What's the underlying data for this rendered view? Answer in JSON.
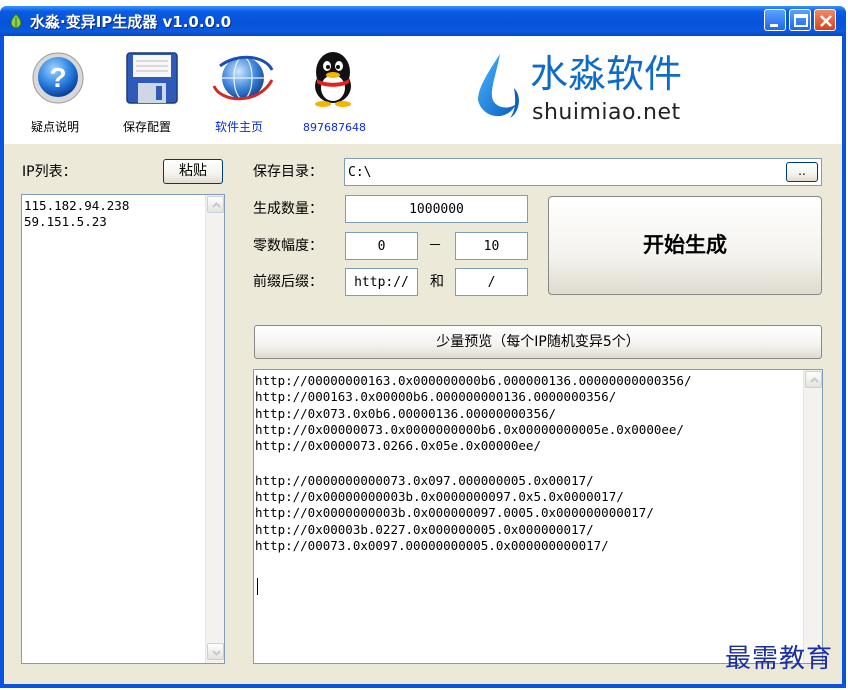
{
  "window": {
    "title": "水淼·变异IP生成器 v1.0.0.0"
  },
  "toolbar": {
    "items": [
      {
        "label": "疑点说明",
        "icon": "help-question-icon"
      },
      {
        "label": "保存配置",
        "icon": "floppy-disk-icon"
      },
      {
        "label": "软件主页",
        "icon": "globe-icon"
      },
      {
        "label": "897687648",
        "icon": "qq-penguin-icon"
      }
    ]
  },
  "logo": {
    "title": "水淼软件",
    "subtitle": "shuimiao.net"
  },
  "ip_list": {
    "label": "IP列表：",
    "paste_button": "粘贴",
    "lines": [
      "115.182.94.238",
      "59.151.5.23"
    ]
  },
  "form": {
    "save_dir_label": "保存目录：",
    "save_dir_value": "C:\\",
    "browse_button": "..",
    "count_label": "生成数量：",
    "count_value": "1000000",
    "zero_label": "零数幅度：",
    "zero_min": "0",
    "zero_sep": "－",
    "zero_max": "10",
    "prefix_label": "前缀后缀：",
    "prefix_value": "http://",
    "and_label": "和",
    "suffix_value": "/",
    "start_button": "开始生成",
    "preview_button": "少量预览（每个IP随机变异5个）"
  },
  "preview": {
    "lines": [
      "http://00000000163.0x000000000b6.000000136.00000000000356/",
      "http://000163.0x00000b6.000000000136.0000000356/",
      "http://0x073.0x0b6.00000136.00000000356/",
      "http://0x00000073.0x0000000000b6.0x00000000005e.0x0000ee/",
      "http://0x0000073.0266.0x05e.0x00000ee/",
      "",
      "http://0000000000073.0x097.000000005.0x00017/",
      "http://0x00000000003b.0x0000000097.0x5.0x0000017/",
      "http://0x0000000003b.0x000000097.0005.0x000000000017/",
      "http://0x00003b.0227.0x000000005.0x000000017/",
      "http://00073.0x0097.00000000005.0x000000000017/"
    ]
  },
  "watermark": "最需教育"
}
